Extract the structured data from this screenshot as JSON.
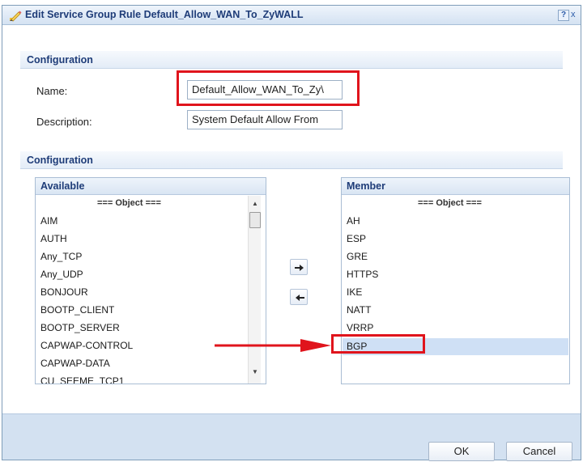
{
  "dialog": {
    "title": "Edit Service Group Rule Default_Allow_WAN_To_ZyWALL",
    "help_label": "?",
    "close_label": "x",
    "edit_icon": "pencil-icon"
  },
  "section1": {
    "title": "Configuration",
    "name_label": "Name:",
    "name_value": "Default_Allow_WAN_To_ZyWALL",
    "name_visible": "Default_Allow_WAN_To_Zy\\",
    "description_label": "Description:",
    "description_value": "System Default Allow From"
  },
  "section2": {
    "title": "Configuration"
  },
  "available": {
    "header": "Available",
    "group": "=== Object ===",
    "items": [
      "AIM",
      "AUTH",
      "Any_TCP",
      "Any_UDP",
      "BONJOUR",
      "BOOTP_CLIENT",
      "BOOTP_SERVER",
      "CAPWAP-CONTROL",
      "CAPWAP-DATA",
      "CU_SEEME_TCP1"
    ]
  },
  "member": {
    "header": "Member",
    "group": "=== Object ===",
    "items": [
      "AH",
      "ESP",
      "GRE",
      "HTTPS",
      "IKE",
      "NATT",
      "VRRP",
      "BGP"
    ],
    "selected": "BGP"
  },
  "buttons": {
    "add_icon": "arrow-right-icon",
    "remove_icon": "arrow-left-icon",
    "ok": "OK",
    "cancel": "Cancel"
  },
  "annotations": {
    "highlight_color": "#e0141c"
  },
  "colors": {
    "heading": "#1e3c78",
    "footer": "#d3e1f1",
    "selection": "#cfe0f5"
  }
}
